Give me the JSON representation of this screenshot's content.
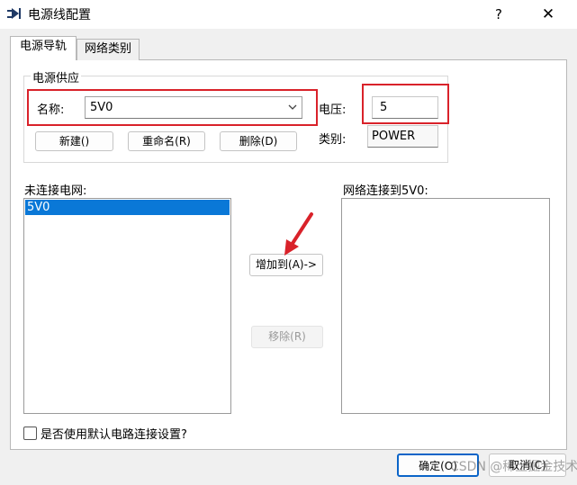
{
  "window": {
    "title": "电源线配置",
    "help_glyph": "?",
    "close_glyph": "✕"
  },
  "tabs": [
    {
      "label": "电源导轨",
      "selected": true
    },
    {
      "label": "网络类别",
      "selected": false
    }
  ],
  "power_supply": {
    "group_label": "电源供应",
    "name_label": "名称:",
    "name_value": "5V0",
    "voltage_label": "电压:",
    "voltage_value": "5",
    "class_label": "类别:",
    "class_value": "POWER",
    "new_button": "新建()",
    "rename_button": "重命名(R)",
    "delete_button": "删除(D)"
  },
  "unconnected": {
    "label": "未连接电网:",
    "items": [
      "5V0"
    ]
  },
  "connected": {
    "label": "网络连接到5V0:",
    "items": []
  },
  "actions": {
    "add_button": "增加到(A)->",
    "remove_button": "移除(R)"
  },
  "default_setting": {
    "label": "是否使用默认电路连接设置?",
    "checked": false
  },
  "footer": {
    "ok_button": "确定(O)",
    "cancel_button": "取消(C)"
  },
  "watermark": "CSDN @稀土掘金技术社区",
  "colors": {
    "highlight_red": "#d9222a",
    "selection_blue": "#0a78d7"
  }
}
